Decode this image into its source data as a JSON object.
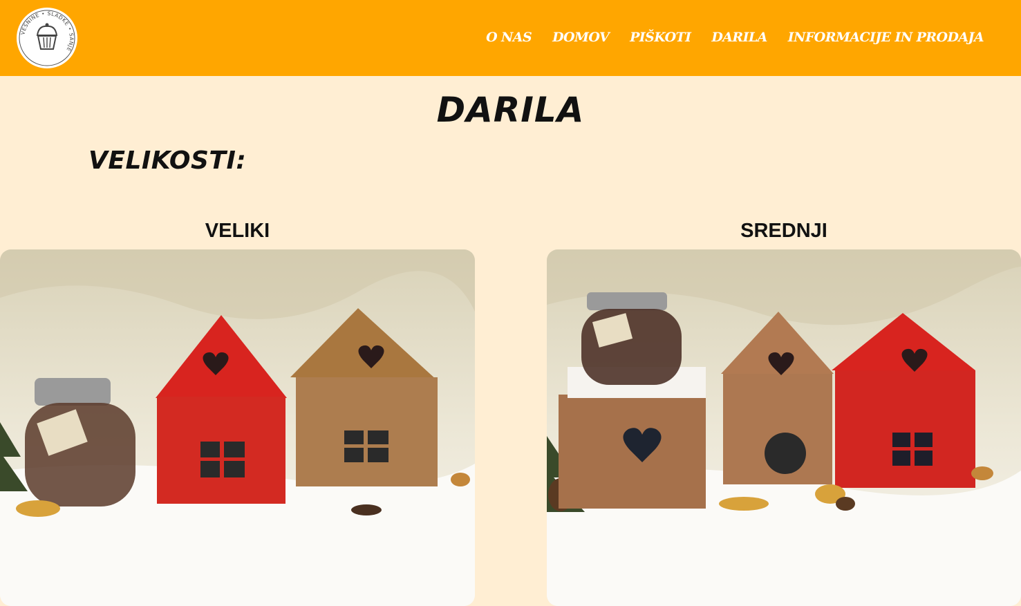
{
  "header": {
    "logo": {
      "icon": "cupcake-logo-icon",
      "text": "VESNINE • SLADKE • SANJE"
    },
    "nav": [
      {
        "label": "O NAS"
      },
      {
        "label": "DOMOV"
      },
      {
        "label": "PIŠKOTI"
      },
      {
        "label": "DARILA"
      },
      {
        "label": "INFORMACIJE IN PRODAJA"
      }
    ]
  },
  "main": {
    "title": "DARILA",
    "subtitle": "VELIKOSTI:",
    "products": [
      {
        "label": "VELIKI",
        "image": "gift-boxes-large-photo"
      },
      {
        "label": "SREDNJI",
        "image": "gift-boxes-medium-photo"
      }
    ]
  },
  "colors": {
    "header_bg": "#ffa600",
    "page_bg": "#ffeed3",
    "nav_text": "#ffffff",
    "heading_text": "#111111"
  }
}
